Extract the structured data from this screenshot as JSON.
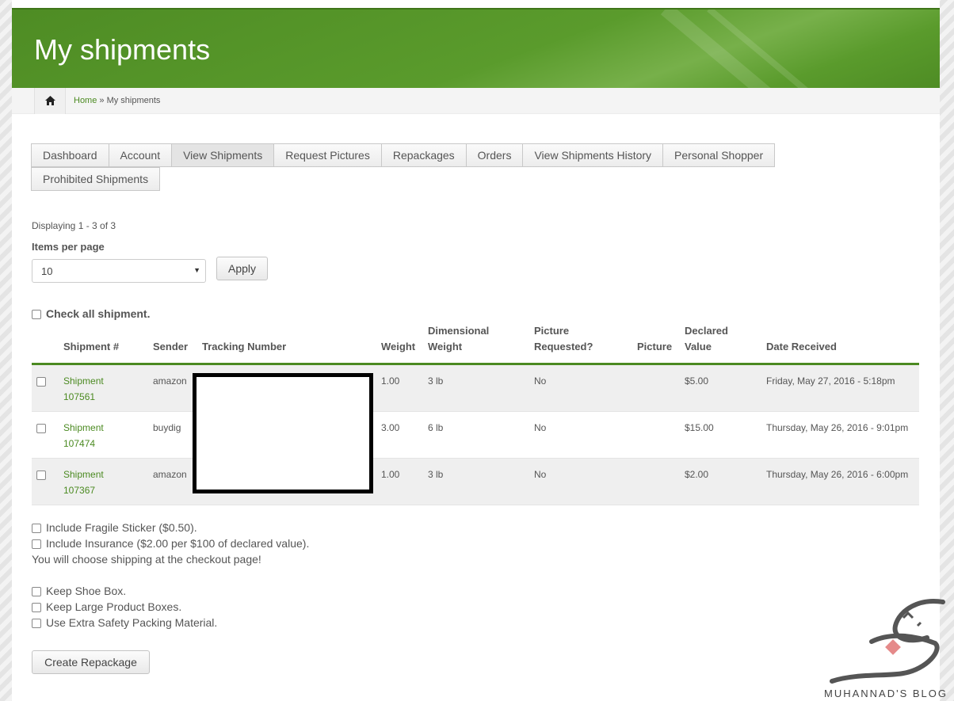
{
  "header": {
    "title": "My shipments"
  },
  "breadcrumb": {
    "home": "Home",
    "separator": " » ",
    "current": "My shipments"
  },
  "tabs": [
    "Dashboard",
    "Account",
    "View Shipments",
    "Request Pictures",
    "Repackages",
    "Orders",
    "View Shipments History",
    "Personal Shopper",
    "Prohibited Shipments"
  ],
  "active_tab": "View Shipments",
  "listing": {
    "displaying": "Displaying 1 - 3 of 3",
    "items_per_page_label": "Items per page",
    "items_per_page_value": "10",
    "apply_label": "Apply",
    "check_all_label": "Check all shipment."
  },
  "table": {
    "headers": {
      "shipment": "Shipment #",
      "sender": "Sender",
      "tracking": "Tracking Number",
      "weight": "Weight",
      "dim_weight_1": "Dimensional",
      "dim_weight_2": "Weight",
      "pic_req_1": "Picture",
      "pic_req_2": "Requested?",
      "picture": "Picture",
      "declared_1": "Declared",
      "declared_2": "Value",
      "date": "Date Received"
    },
    "rows": [
      {
        "shipment_1": "Shipment",
        "shipment_2": "107561",
        "sender": "amazon",
        "tracking": "",
        "weight": "1.00",
        "dim_weight": "3 lb",
        "picture_requested": "No",
        "picture": "",
        "declared_value": "$5.00",
        "date_received": "Friday, May 27, 2016 - 5:18pm"
      },
      {
        "shipment_1": "Shipment",
        "shipment_2": "107474",
        "sender": "buydig",
        "tracking": "",
        "weight": "3.00",
        "dim_weight": "6 lb",
        "picture_requested": "No",
        "picture": "",
        "declared_value": "$15.00",
        "date_received": "Thursday, May 26, 2016 - 9:01pm"
      },
      {
        "shipment_1": "Shipment",
        "shipment_2": "107367",
        "sender": "amazon",
        "tracking": "",
        "weight": "1.00",
        "dim_weight": "3 lb",
        "picture_requested": "No",
        "picture": "",
        "declared_value": "$2.00",
        "date_received": "Thursday, May 26, 2016 - 6:00pm"
      }
    ]
  },
  "options": {
    "fragile": "Include Fragile Sticker ($0.50).",
    "insurance": "Include Insurance ($2.00 per $100 of declared value).",
    "shipping_note": "You will choose shipping at the checkout page!",
    "shoe_box": "Keep Shoe Box.",
    "large_boxes": "Keep Large Product Boxes.",
    "extra_safety": "Use Extra Safety Packing Material."
  },
  "create_repackage_label": "Create Repackage",
  "watermark": {
    "text": "MUHANNAD'S BLOG"
  },
  "colors": {
    "brand_green": "#5a9b2c",
    "link_green": "#4b8a21"
  }
}
